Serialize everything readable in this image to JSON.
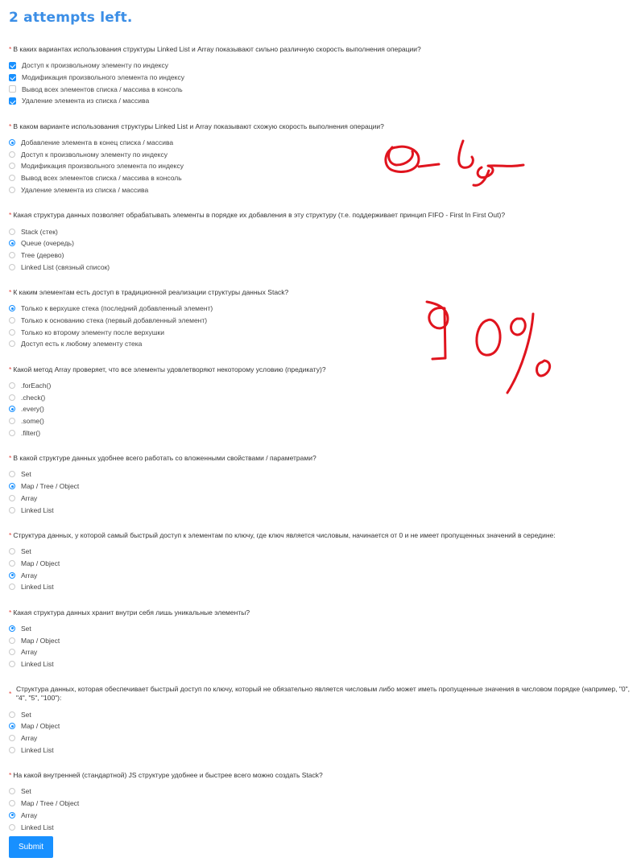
{
  "header": {
    "attempts_text": "2 attempts left."
  },
  "questions": [
    {
      "title": "В каких вариантах использования структуры Linked List и Array показывают сильно различную скорость выполнения операции?",
      "type": "checkbox",
      "options": [
        {
          "label": "Доступ к произвольному элементу по индексу",
          "checked": true
        },
        {
          "label": "Модификация произвольного элемента по индексу",
          "checked": true
        },
        {
          "label": "Вывод всех элементов списка / массива в консоль",
          "checked": false
        },
        {
          "label": "Удаление элемента из списка / массива",
          "checked": true
        }
      ]
    },
    {
      "title": "В каком варианте использования структуры Linked List и Array показывают схожую скорость выполнения операции?",
      "type": "radio",
      "options": [
        {
          "label": "Добавление элемента в конец списка / массива",
          "checked": true
        },
        {
          "label": "Доступ к произвольному элементу по индексу",
          "checked": false
        },
        {
          "label": "Модификация произвольного элемента по индексу",
          "checked": false
        },
        {
          "label": "Вывод всех элементов списка / массива в консоль",
          "checked": false
        },
        {
          "label": "Удаление элемента из списка / массива",
          "checked": false
        }
      ]
    },
    {
      "title": "Какая структура данных позволяет обрабатывать элементы в порядке их добавления в эту структуру (т.е. поддерживает принцип FIFO - First In First Out)?",
      "type": "radio",
      "options": [
        {
          "label": "Stack (стек)",
          "checked": false
        },
        {
          "label": "Queue (очередь)",
          "checked": true
        },
        {
          "label": "Tree (дерево)",
          "checked": false
        },
        {
          "label": "Linked List (связный список)",
          "checked": false
        }
      ]
    },
    {
      "title": "К каким элементам есть доступ в традиционной реализации структуры данных Stack?",
      "type": "radio",
      "options": [
        {
          "label": "Только к верхушке стека (последний добавленный элемент)",
          "checked": true
        },
        {
          "label": "Только к основанию стека (первый добавленный элемент)",
          "checked": false
        },
        {
          "label": "Только ко второму элементу после верхушки",
          "checked": false
        },
        {
          "label": "Доступ есть к любому элементу стека",
          "checked": false
        }
      ]
    },
    {
      "title": "Какой метод Array проверяет, что все элементы удовлетворяют некоторому условию (предикату)?",
      "type": "radio",
      "options": [
        {
          "label": ".forEach()",
          "checked": false
        },
        {
          "label": ".check()",
          "checked": false
        },
        {
          "label": ".every()",
          "checked": true
        },
        {
          "label": ".some()",
          "checked": false
        },
        {
          "label": ".filter()",
          "checked": false
        }
      ]
    },
    {
      "title": "В какой структуре данных удобнее всего работать со вложенными свойствами / параметрами?",
      "type": "radio",
      "options": [
        {
          "label": "Set",
          "checked": false
        },
        {
          "label": "Map / Tree / Object",
          "checked": true
        },
        {
          "label": "Array",
          "checked": false
        },
        {
          "label": "Linked List",
          "checked": false
        }
      ]
    },
    {
      "title": "Структура данных, у которой самый быстрый доступ к элементам по ключу, где ключ является числовым, начинается от 0 и не имеет пропущенных значений в середине:",
      "type": "radio",
      "options": [
        {
          "label": "Set",
          "checked": false
        },
        {
          "label": "Map / Object",
          "checked": false
        },
        {
          "label": "Array",
          "checked": true
        },
        {
          "label": "Linked List",
          "checked": false
        }
      ]
    },
    {
      "title": "Какая структура данных хранит внутри себя лишь уникальные элементы?",
      "type": "radio",
      "options": [
        {
          "label": "Set",
          "checked": true
        },
        {
          "label": "Map / Object",
          "checked": false
        },
        {
          "label": "Array",
          "checked": false
        },
        {
          "label": "Linked List",
          "checked": false
        }
      ]
    },
    {
      "title": "Структура данных, которая обеспечивает быстрый доступ по ключу, который не обязательно является числовым либо может иметь пропущенные значения в числовом порядке (например, \"0\", \"4\", \"5\", \"100\"):",
      "type": "radio",
      "wrap": true,
      "options": [
        {
          "label": "Set",
          "checked": false
        },
        {
          "label": "Map / Object",
          "checked": true
        },
        {
          "label": "Array",
          "checked": false
        },
        {
          "label": "Linked List",
          "checked": false
        }
      ]
    },
    {
      "title": "На какой внутренней (стандартной) JS структуре удобнее и быстрее всего можно создать Stack?",
      "type": "radio",
      "options": [
        {
          "label": "Set",
          "checked": false
        },
        {
          "label": "Map / Tree / Object",
          "checked": false
        },
        {
          "label": "Array",
          "checked": true
        },
        {
          "label": "Linked List",
          "checked": false
        }
      ]
    }
  ],
  "submit_label": "Submit",
  "annotations": {
    "ink_color": "#e0141e",
    "note1": "O(1)",
    "note2": "90%"
  }
}
